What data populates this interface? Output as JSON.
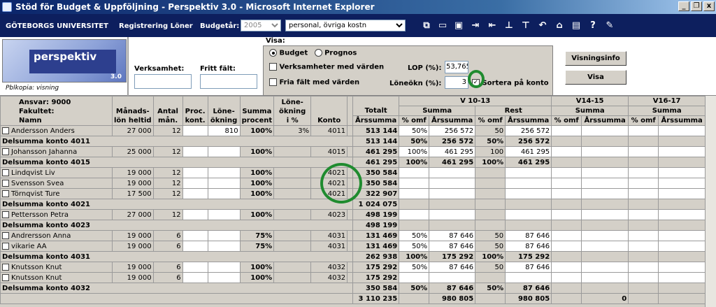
{
  "window": {
    "title": "Stöd för Budget & Uppföljning - Perspektiv 3.0 - Microsoft Internet Explorer",
    "controls": [
      "_",
      "❐",
      "x"
    ]
  },
  "nav": {
    "org": "GÖTEBORGS UNIVERSITET",
    "registrering": "Registrering Löner",
    "budgetar_label": "Budgetår:",
    "budgetar_value": "2005",
    "category_value": "personal, övriga kostn"
  },
  "logo": {
    "name": "perspektiv",
    "version": "3.0"
  },
  "panel": {
    "pblkopia": "Pblkopia: visning",
    "verksamhet_label": "Verksamhet:",
    "fritt_falt_label": "Fritt fält:",
    "visa_label": "Visa:",
    "budget_label": "Budget",
    "prognos_label": "Prognos",
    "verks_med_varden": "Verksamheter med värden",
    "fria_falt_med_varden": "Fria fält med värden",
    "lop_label": "LOP (%):",
    "lop_value": "53,765",
    "loneokn_label": "Löneökn (%):",
    "loneokn_value": "3",
    "sortera_label": "Sortera på konto",
    "visningsinfo_btn": "Visningsinfo",
    "visa_btn": "Visa"
  },
  "grid": {
    "ansvar": "Ansvar: 9000",
    "fakultet": "Fakultet:",
    "namn": "Namn",
    "col_manadslon": "Månads-",
    "col_manadslon2": "lön heltid",
    "col_antal": "Antal",
    "col_antal2": "mån.",
    "col_proc": "Proc.",
    "col_proc2": "kont.",
    "col_lone": "Löne-",
    "col_lone2": "ökning",
    "col_summa": "Summa",
    "col_summa2": "procent",
    "col_loneokn": "Löne-",
    "col_loneokn2": "ökning",
    "col_loneokn3": "i %",
    "col_konto": "Konto",
    "col_totalt": "Totalt",
    "col_arssumma": "Årssumma",
    "v1013": "V 10-13",
    "summa": "Summa",
    "rest": "Rest",
    "omf": "% omf",
    "arssumma": "Årssumma",
    "v1415": "V14-15",
    "v1617": "V16-17",
    "rows": [
      {
        "t": "p",
        "name": "Andersson Anders",
        "lon": "27 000",
        "man": "12",
        "proc": "",
        "okn": "810",
        "sp": "100%",
        "okp": "3%",
        "konto": "4011",
        "tot": "513 144",
        "o1": "50%",
        "s1": "256 572",
        "o2": "50",
        "s2": "256 572"
      },
      {
        "t": "s",
        "name": "Delsumma konto 4011",
        "tot": "513 144",
        "o1": "50%",
        "s1": "256 572",
        "o2": "50%",
        "s2": "256 572"
      },
      {
        "t": "p",
        "name": "Johansson Jahanna",
        "lon": "25 000",
        "man": "12",
        "proc": "",
        "okn": "",
        "sp": "100%",
        "okp": "",
        "konto": "4015",
        "tot": "461 295",
        "o1": "100%",
        "s1": "461 295",
        "o2": "100",
        "s2": "461 295"
      },
      {
        "t": "s",
        "name": "Delsumma konto 4015",
        "tot": "461 295",
        "o1": "100%",
        "s1": "461 295",
        "o2": "100%",
        "s2": "461 295"
      },
      {
        "t": "p",
        "name": "Lindqvist Liv",
        "lon": "19 000",
        "man": "12",
        "proc": "",
        "okn": "",
        "sp": "100%",
        "okp": "",
        "konto": "4021",
        "tot": "350 584",
        "o1": "",
        "s1": "",
        "o2": "",
        "s2": ""
      },
      {
        "t": "p",
        "name": "Svensson Svea",
        "lon": "19 000",
        "man": "12",
        "proc": "",
        "okn": "",
        "sp": "100%",
        "okp": "",
        "konto": "4021",
        "tot": "350 584",
        "o1": "",
        "s1": "",
        "o2": "",
        "s2": ""
      },
      {
        "t": "p",
        "name": "Törnqvist Ture",
        "lon": "17 500",
        "man": "12",
        "proc": "",
        "okn": "",
        "sp": "100%",
        "okp": "",
        "konto": "4021",
        "tot": "322 907",
        "o1": "",
        "s1": "",
        "o2": "",
        "s2": ""
      },
      {
        "t": "s",
        "name": "Delsumma konto 4021",
        "tot": "1 024 075",
        "o1": "",
        "s1": "",
        "o2": "",
        "s2": ""
      },
      {
        "t": "p",
        "name": "Pettersson Petra",
        "lon": "27 000",
        "man": "12",
        "proc": "",
        "okn": "",
        "sp": "100%",
        "okp": "",
        "konto": "4023",
        "tot": "498 199",
        "o1": "",
        "s1": "",
        "o2": "",
        "s2": ""
      },
      {
        "t": "s",
        "name": "Delsumma konto 4023",
        "tot": "498 199",
        "o1": "",
        "s1": "",
        "o2": "",
        "s2": ""
      },
      {
        "t": "p",
        "name": "Andrersson Anna",
        "lon": "19 000",
        "man": "6",
        "proc": "",
        "okn": "",
        "sp": "75%",
        "okp": "",
        "konto": "4031",
        "tot": "131 469",
        "o1": "50%",
        "s1": "87 646",
        "o2": "50",
        "s2": "87 646"
      },
      {
        "t": "p",
        "name": "vikarie AA",
        "lon": "19 000",
        "man": "6",
        "proc": "",
        "okn": "",
        "sp": "75%",
        "okp": "",
        "konto": "4031",
        "tot": "131 469",
        "o1": "50%",
        "s1": "87 646",
        "o2": "50",
        "s2": "87 646"
      },
      {
        "t": "s",
        "name": "Delsumma konto 4031",
        "tot": "262 938",
        "o1": "100%",
        "s1": "175 292",
        "o2": "100%",
        "s2": "175 292"
      },
      {
        "t": "p",
        "name": "Knutsson Knut",
        "lon": "19 000",
        "man": "6",
        "proc": "",
        "okn": "",
        "sp": "100%",
        "okp": "",
        "konto": "4032",
        "tot": "175 292",
        "o1": "50%",
        "s1": "87 646",
        "o2": "50",
        "s2": "87 646"
      },
      {
        "t": "p",
        "name": "Knutsson Knut",
        "lon": "19 000",
        "man": "6",
        "proc": "",
        "okn": "",
        "sp": "100%",
        "okp": "",
        "konto": "4032",
        "tot": "175 292",
        "o1": "",
        "s1": "",
        "o2": "",
        "s2": ""
      },
      {
        "t": "s",
        "name": "Delsumma konto 4032",
        "tot": "350 584",
        "o1": "50%",
        "s1": "87 646",
        "o2": "50%",
        "s2": "87 646"
      },
      {
        "t": "g",
        "name": "",
        "tot": "3 110 235",
        "o1": "",
        "s1": "980 805",
        "o2": "",
        "s2": "980 805",
        "v14": "0"
      }
    ]
  }
}
